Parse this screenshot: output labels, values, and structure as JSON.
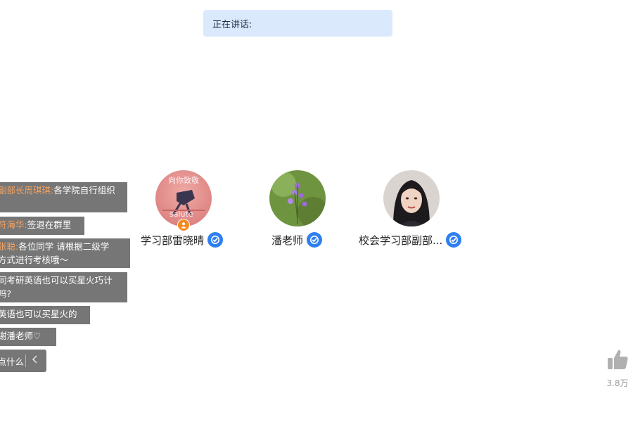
{
  "speaking_banner": {
    "text": "正在讲话:"
  },
  "chat": {
    "messages": [
      {
        "name": "副部长周琪琪:",
        "lines": [
          "各学院自行组织",
          ""
        ]
      },
      {
        "name": "符海华:",
        "lines": [
          "签退在群里"
        ]
      },
      {
        "name": "张聪:",
        "lines": [
          "各位同学 请根据二级学",
          "方式进行考核哦～"
        ]
      },
      {
        "name": "",
        "lines": [
          "同考研英语也可以买星火巧计",
          "吗?"
        ]
      },
      {
        "name": "",
        "lines": [
          "英语也可以买星火的"
        ]
      },
      {
        "name": "",
        "lines": [
          "谢潘老师♡"
        ]
      }
    ],
    "input_placeholder": "说点什么...",
    "collapse_icon": "chevron-left-icon"
  },
  "speakers": [
    {
      "name": "学习部雷晓晴",
      "avatar_caption_top": "向你致敬",
      "avatar_caption_bottom": "salute",
      "verified": true,
      "host": true
    },
    {
      "name": "潘老师",
      "verified": true,
      "host": false
    },
    {
      "name": "校会学习部副部...",
      "verified": true,
      "host": false
    }
  ],
  "like": {
    "icon": "thumbs-up-icon",
    "count": "3.8万"
  },
  "colors": {
    "banner_bg": "#dbe9fd",
    "chat_bg": "#5f5f5f",
    "chat_name": "#f5a25d",
    "verify": "#2e7ff0",
    "host": "#f58a23"
  }
}
